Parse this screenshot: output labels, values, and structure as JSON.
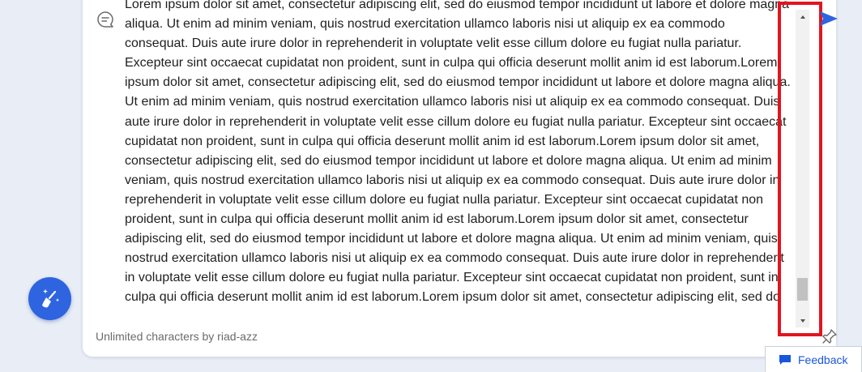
{
  "editor": {
    "text": "Lorem ipsum dolor sit amet, consectetur adipiscing elit, sed do eiusmod tempor incididunt ut labore et dolore magna aliqua. Ut enim ad minim veniam, quis nostrud exercitation ullamco laboris nisi ut aliquip ex ea commodo consequat. Duis aute irure dolor in reprehenderit in voluptate velit esse cillum dolore eu fugiat nulla pariatur. Excepteur sint occaecat cupidatat non proident, sunt in culpa qui officia deserunt mollit anim id est laborum.Lorem ipsum dolor sit amet, consectetur adipiscing elit, sed do eiusmod tempor incididunt ut labore et dolore magna aliqua. Ut enim ad minim veniam, quis nostrud exercitation ullamco laboris nisi ut aliquip ex ea commodo consequat. Duis aute irure dolor in reprehenderit in voluptate velit esse cillum dolore eu fugiat nulla pariatur. Excepteur sint occaecat cupidatat non proident, sunt in culpa qui officia deserunt mollit anim id est laborum.Lorem ipsum dolor sit amet, consectetur adipiscing elit, sed do eiusmod tempor incididunt ut labore et dolore magna aliqua. Ut enim ad minim veniam, quis nostrud exercitation ullamco laboris nisi ut aliquip ex ea commodo consequat. Duis aute irure dolor in reprehenderit in voluptate velit esse cillum dolore eu fugiat nulla pariatur. Excepteur sint occaecat cupidatat non proident, sunt in culpa qui officia deserunt mollit anim id est laborum.Lorem ipsum dolor sit amet, consectetur adipiscing elit, sed do eiusmod tempor incididunt ut labore et dolore magna aliqua. Ut enim ad minim veniam, quis nostrud exercitation ullamco laboris nisi ut aliquip ex ea commodo consequat. Duis aute irure dolor in reprehenderit in voluptate velit esse cillum dolore eu fugiat nulla pariatur. Excepteur sint occaecat cupidatat non proident, sunt in culpa qui officia deserunt mollit anim id est laborum.Lorem ipsum dolor sit amet, consectetur adipiscing elit, sed do",
    "footer": "Unlimited characters by riad-azz",
    "scroll_position": 0.95
  },
  "feedback": {
    "label": "Feedback"
  },
  "icons": {
    "chat": "chat-bubble-icon",
    "send": "send-icon",
    "pin": "pin-icon",
    "clean": "broom-sparkle-icon",
    "feedback": "message-icon"
  },
  "colors": {
    "accent": "#2e64e0",
    "highlight": "#e3141f",
    "feedback_text": "#1a56db"
  }
}
